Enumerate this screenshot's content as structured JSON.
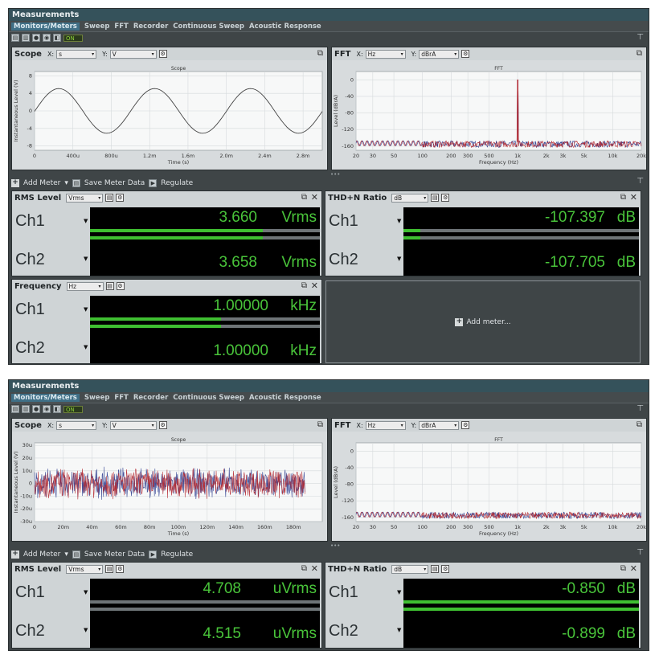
{
  "app": {
    "title": "Measurements",
    "tabs": [
      "Monitors/Meters",
      "Sweep",
      "FFT",
      "Recorder",
      "Continuous Sweep",
      "Acoustic Response"
    ],
    "on_label": "ON"
  },
  "scope_panel": {
    "title": "Scope",
    "x_label": "X:",
    "x_unit": "s",
    "y_label": "Y:",
    "y_unit": "V"
  },
  "fft_panel": {
    "title": "FFT",
    "x_label": "X:",
    "x_unit": "Hz",
    "y_label": "Y:",
    "y_unit": "dBrA"
  },
  "meters_toolbar": {
    "add_meter": "Add Meter",
    "save_meter_data": "Save Meter Data",
    "regulate": "Regulate"
  },
  "view1": {
    "rms": {
      "title": "RMS Level",
      "unit_select": "Vrms",
      "ch1": {
        "label": "Ch1",
        "value": "3.660",
        "unit": "Vrms",
        "fill": 0.75
      },
      "ch2": {
        "label": "Ch2",
        "value": "3.658",
        "unit": "Vrms",
        "fill": 0.75
      }
    },
    "thdn": {
      "title": "THD+N Ratio",
      "unit_select": "dB",
      "ch1": {
        "label": "Ch1",
        "value": "-107.397",
        "unit": "dB",
        "fill": 0.07
      },
      "ch2": {
        "label": "Ch2",
        "value": "-107.705",
        "unit": "dB",
        "fill": 0.07
      }
    },
    "freq": {
      "title": "Frequency",
      "unit_select": "Hz",
      "ch1": {
        "label": "Ch1",
        "value": "1.00000",
        "unit": "kHz",
        "fill": 0.57
      },
      "ch2": {
        "label": "Ch2",
        "value": "1.00000",
        "unit": "kHz",
        "fill": 0.57
      }
    },
    "add_meter_placeholder": "Add meter..."
  },
  "view2": {
    "rms": {
      "title": "RMS Level",
      "unit_select": "Vrms",
      "ch1": {
        "label": "Ch1",
        "value": "4.708",
        "unit": "uVrms",
        "fill": 0.0
      },
      "ch2": {
        "label": "Ch2",
        "value": "4.515",
        "unit": "uVrms",
        "fill": 0.0
      }
    },
    "thdn": {
      "title": "THD+N Ratio",
      "unit_select": "dB",
      "ch1": {
        "label": "Ch1",
        "value": "-0.850",
        "unit": "dB",
        "fill": 1.0
      },
      "ch2": {
        "label": "Ch2",
        "value": "-0.899",
        "unit": "dB",
        "fill": 1.0
      }
    }
  },
  "chart_data": [
    {
      "id": "scope1",
      "type": "line",
      "title": "Scope",
      "xlabel": "Time (s)",
      "ylabel": "Instantaneous Level (V)",
      "xlim": [
        0,
        0.003
      ],
      "ylim": [
        -9,
        9
      ],
      "xticks": [
        "0",
        "400u",
        "800u",
        "1.2m",
        "1.6m",
        "2.0m",
        "2.4m",
        "2.8m"
      ],
      "yticks": [
        "-8",
        "-4",
        "0",
        "4",
        "8"
      ],
      "series": [
        {
          "amplitude": 5.1,
          "frequency_hz": 1000,
          "phase_start": "0 (rising)"
        }
      ]
    },
    {
      "id": "fft1",
      "type": "line",
      "title": "FFT",
      "xlabel": "Frequency (Hz)",
      "ylabel": "Level (dBrA)",
      "xscale": "log",
      "xlim": [
        20,
        20000
      ],
      "ylim": [
        -170,
        20
      ],
      "xticks": [
        "20",
        "30",
        "50",
        "100",
        "200",
        "300",
        "500",
        "1k",
        "2k",
        "3k",
        "5k",
        "10k",
        "20k"
      ],
      "yticks": [
        "0",
        "-40",
        "-80",
        "-120",
        "-160"
      ],
      "series": [
        {
          "peak_hz": 1000,
          "peak_dbra": 0,
          "noise_floor_dbra": -150
        }
      ]
    },
    {
      "id": "scope2",
      "type": "line",
      "title": "Scope",
      "xlabel": "Time (s)",
      "ylabel": "Instantaneous Level (V)",
      "xlim": [
        0,
        0.2
      ],
      "ylim": [
        -30,
        32
      ],
      "xticks": [
        "0",
        "20m",
        "40m",
        "60m",
        "80m",
        "100m",
        "120m",
        "140m",
        "160m",
        "180m"
      ],
      "yticks": [
        "30u",
        "20u",
        "10u",
        "0",
        "-10u",
        "-20u",
        "-30u"
      ],
      "series": [
        {
          "noise_amplitude_u": 12
        }
      ]
    },
    {
      "id": "fft2",
      "type": "line",
      "title": "FFT",
      "xlabel": "Frequency (Hz)",
      "ylabel": "Level (dBrA)",
      "xscale": "log",
      "xlim": [
        20,
        20000
      ],
      "ylim": [
        -170,
        20
      ],
      "xticks": [
        "20",
        "30",
        "50",
        "100",
        "200",
        "300",
        "500",
        "1k",
        "2k",
        "3k",
        "5k",
        "10k",
        "20k"
      ],
      "yticks": [
        "0",
        "-40",
        "-80",
        "-120",
        "-160"
      ],
      "series": [
        {
          "noise_floor_dbra": -150
        }
      ]
    }
  ]
}
